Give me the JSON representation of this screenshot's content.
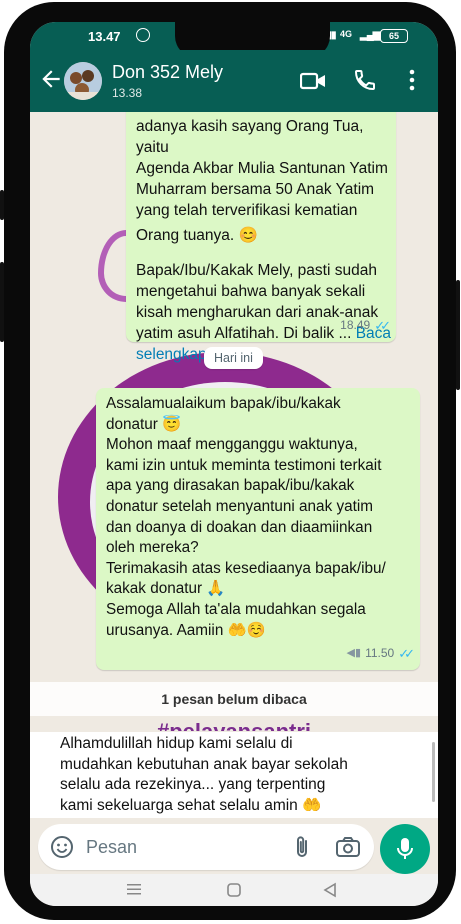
{
  "status_bar": {
    "time": "13.47",
    "battery": "65"
  },
  "header": {
    "contact_name": "Don 352 Mely",
    "last_seen": "13.38"
  },
  "messages": {
    "m1": {
      "lines": [
        "adanya kasih sayang Orang Tua, yaitu",
        "Agenda Akbar Mulia Santunan Yatim",
        "Muharram bersama 50 Anak Yatim",
        "yang telah terverifikasi kematian",
        "Orang tuanya. 😊",
        "",
        "Bapak/Ibu/Kakak Mely, pasti sudah",
        "mengetahui bahwa banyak sekali",
        "kisah mengharukan dari anak-anak"
      ],
      "last_line_text": "yatim asuh Alfatihah. Di balik ...",
      "read_more_1": "Baca",
      "read_more_2": "selengkapnya",
      "time": "18.49"
    },
    "date_divider": "Hari ini",
    "m2": {
      "lines": [
        "Assalamualaikum bapak/ibu/kakak",
        "donatur 😇",
        "Mohon maaf mengganggu waktunya,",
        "kami izin untuk meminta testimoni terkait",
        "apa yang dirasakan bapak/ibu/kakak",
        "donatur setelah menyantuni anak yatim",
        "dan doanya di doakan dan diaamiinkan",
        "oleh mereka?",
        "Terimakasih atas kesediaanya bapak/ibu/",
        "kakak donatur 🙏",
        "Semoga Allah ta'ala mudahkan segala",
        "urusanya. Aamiin 🤲☺️"
      ],
      "time": "11.50"
    },
    "unread_label": "1 pesan belum dibaca",
    "background_hashtag": "#pelayansantri",
    "m3": {
      "lines": [
        "Alhamdulillah hidup kami selalu di",
        "mudahkan kebutuhan anak bayar sekolah",
        "selalu ada rezekinya... yang terpenting",
        "kami sekeluarga sehat selalu amin 🤲"
      ]
    }
  },
  "composer": {
    "placeholder": "Pesan"
  },
  "icons": {
    "back": "arrow-left-icon",
    "video": "video-call-icon",
    "call": "phone-icon",
    "menu": "more-vertical-icon",
    "emoji": "emoji-icon",
    "attach": "paperclip-icon",
    "camera": "camera-icon",
    "mic": "microphone-icon"
  },
  "colors": {
    "header": "#075e54",
    "outgoing_bubble": "#dcf8c6",
    "accent": "#00a884",
    "read_ticks": "#34b7f1",
    "link": "#027eb5"
  }
}
